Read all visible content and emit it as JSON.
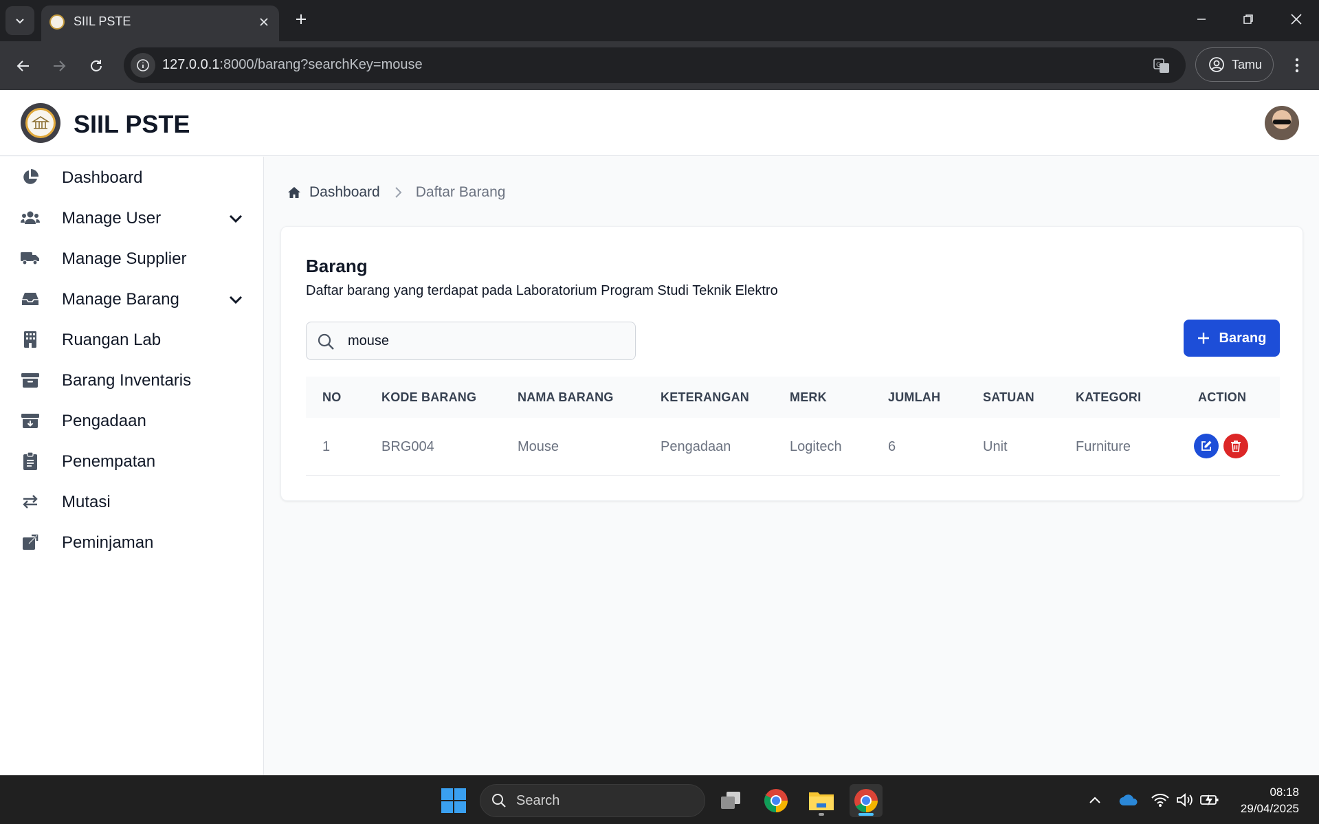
{
  "browser": {
    "tab_title": "SIIL PSTE",
    "url_host": "127.0.0.1",
    "url_rest": ":8000/barang?searchKey=mouse",
    "profile_label": "Tamu"
  },
  "app": {
    "title": "SIIL PSTE"
  },
  "sidebar": {
    "items": [
      {
        "label": "Dashboard",
        "icon": "pie-chart-icon"
      },
      {
        "label": "Manage User",
        "icon": "users-icon",
        "expandable": true
      },
      {
        "label": "Manage Supplier",
        "icon": "truck-icon"
      },
      {
        "label": "Manage Barang",
        "icon": "inbox-icon",
        "expandable": true
      },
      {
        "label": "Ruangan Lab",
        "icon": "building-icon"
      },
      {
        "label": "Barang Inventaris",
        "icon": "archive-icon"
      },
      {
        "label": "Pengadaan",
        "icon": "archive-download-icon"
      },
      {
        "label": "Penempatan",
        "icon": "clipboard-icon"
      },
      {
        "label": "Mutasi",
        "icon": "swap-arrows-icon"
      },
      {
        "label": "Peminjaman",
        "icon": "external-link-icon"
      }
    ]
  },
  "breadcrumb": {
    "home": "Dashboard",
    "current": "Daftar Barang"
  },
  "card": {
    "title": "Barang",
    "subtitle": "Daftar barang yang terdapat pada Laboratorium Program Studi Teknik Elektro",
    "search_value": "mouse",
    "add_button_label": "Barang"
  },
  "table": {
    "headers": [
      "NO",
      "KODE BARANG",
      "NAMA BARANG",
      "KETERANGAN",
      "MERK",
      "JUMLAH",
      "SATUAN",
      "KATEGORI",
      "ACTION"
    ],
    "rows": [
      {
        "no": "1",
        "kode": "BRG004",
        "nama": "Mouse",
        "keterangan": "Pengadaan",
        "merk": "Logitech",
        "jumlah": "6",
        "satuan": "Unit",
        "kategori": "Furniture"
      }
    ]
  },
  "taskbar": {
    "search_placeholder": "Search",
    "time": "08:18",
    "date": "29/04/2025"
  },
  "colors": {
    "primary": "#1d4ed8",
    "danger": "#dc2626",
    "edit": "#1d4ed8"
  }
}
